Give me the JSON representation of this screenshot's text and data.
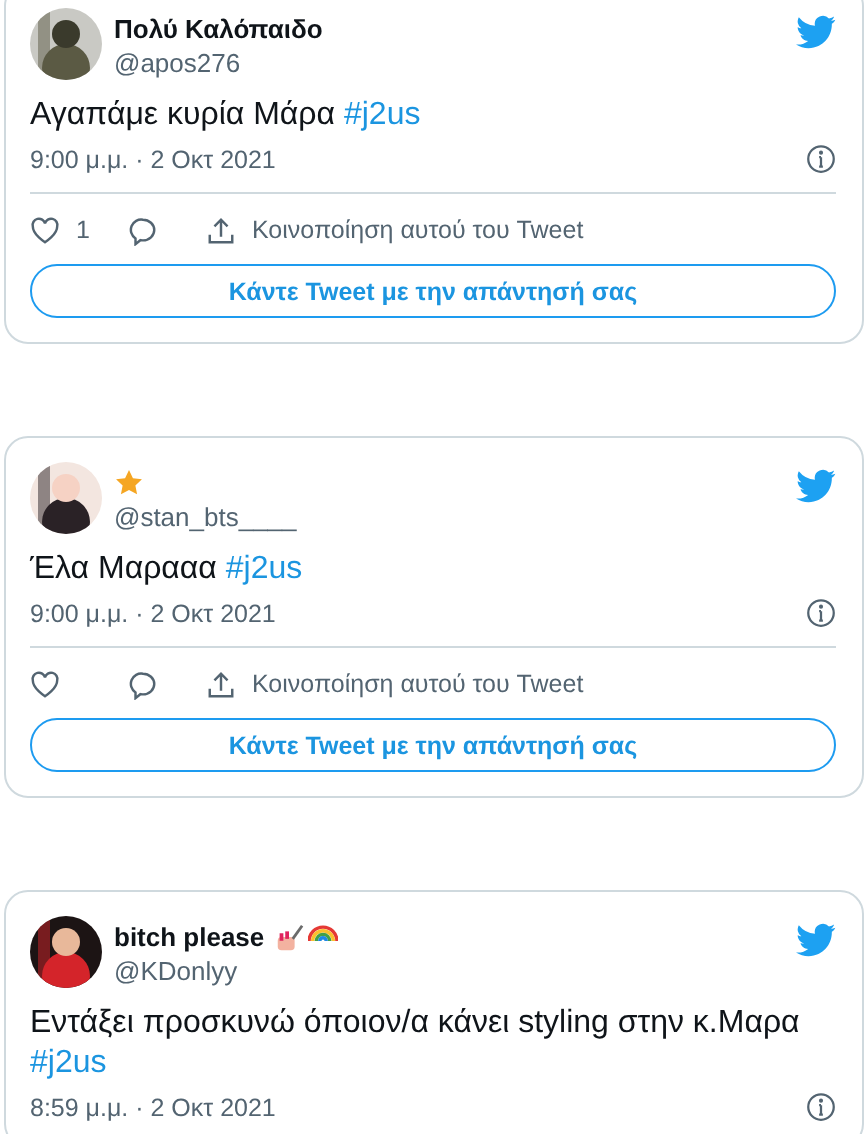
{
  "tweets": [
    {
      "name": "Πολύ Καλόπαιδο",
      "handle": "@apos276",
      "text": "Αγαπάμε κυρία Μάρα ",
      "hashtag": "#j2us",
      "time": "9:00 μ.μ. · 2 Οκτ 2021",
      "likes": "1",
      "share": "Κοινοποίηση αυτού του Tweet",
      "reply": "Κάντε Tweet με την απάντησή σας"
    },
    {
      "handle": "@stan_bts____",
      "text": "Έλα Μαρααα ",
      "hashtag": "#j2us",
      "time": "9:00 μ.μ. · 2 Οκτ 2021",
      "share": "Κοινοποίηση αυτού του Tweet",
      "reply": "Κάντε Tweet με την απάντησή σας"
    },
    {
      "name": "bitch please",
      "handle": "@KDonlyy",
      "text": "Εντάξει προσκυνώ όποιον/α κάνει styling στην κ.Μαρα ",
      "hashtag": "#j2us",
      "time": "8:59 μ.μ. · 2 Οκτ 2021"
    }
  ]
}
